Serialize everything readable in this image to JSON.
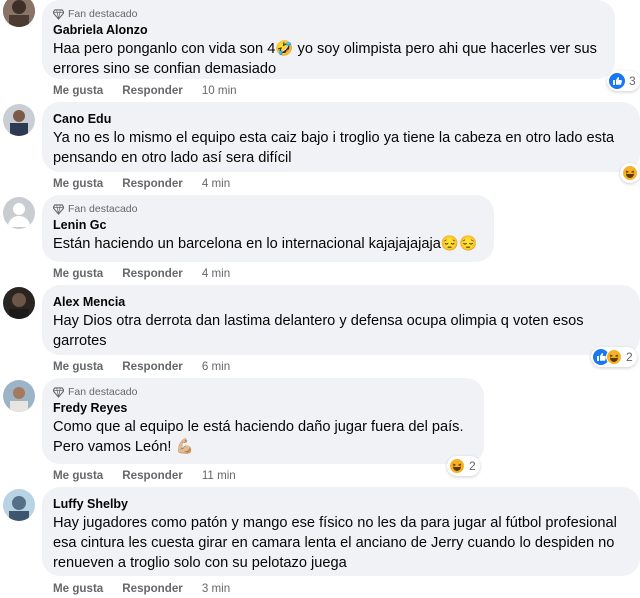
{
  "fan_badge": "Fan destacado",
  "actions": {
    "like": "Me gusta",
    "reply": "Responder"
  },
  "comments": [
    {
      "author": "Gabriela Alonzo",
      "fan": true,
      "lines": [
        "Haa pero ponganlo con vida son 4🤣 yo soy olimpista pero ahi que hacerles ver sus",
        "errores sino se confian demasiado"
      ],
      "time": "10 min",
      "reactions": {
        "types": [
          "like"
        ],
        "count": "3"
      }
    },
    {
      "author": "Cano Edu",
      "fan": false,
      "lines": [
        "Ya no es lo mismo el equipo esta caiz bajo i troglio ya tiene la cabeza en otro lado esta",
        "pensando en otro lado así sera difícil"
      ],
      "time": "4 min",
      "reactions": {
        "types": [
          "haha"
        ],
        "count": ""
      }
    },
    {
      "author": "Lenin Gc",
      "fan": true,
      "lines": [
        "Están haciendo un barcelona en lo internacional kajajajajaja😔😔"
      ],
      "time": "4 min",
      "reactions": null
    },
    {
      "author": "Alex Mencia",
      "fan": false,
      "lines": [
        "Hay Dios otra derrota dan lastima delantero y defensa ocupa olimpia q voten esos",
        "garrotes"
      ],
      "time": "6 min",
      "reactions": {
        "types": [
          "like",
          "haha"
        ],
        "count": "2"
      }
    },
    {
      "author": "Fredy Reyes",
      "fan": true,
      "lines": [
        "Como que al equipo le está haciendo daño jugar fuera del país.",
        "Pero vamos León! 💪🏼"
      ],
      "time": "11 min",
      "reactions": {
        "types": [
          "haha"
        ],
        "count": "2"
      }
    },
    {
      "author": "Luffy Shelby",
      "fan": false,
      "lines": [
        "Hay jugadores como patón y mango ese físico no les da para jugar al fútbol profesional",
        "esa cintura les cuesta girar en camara lenta el anciano de Jerry cuando lo despiden no",
        "renueven a troglio solo con su pelotazo juega"
      ],
      "time": "3 min",
      "reactions": null
    }
  ]
}
